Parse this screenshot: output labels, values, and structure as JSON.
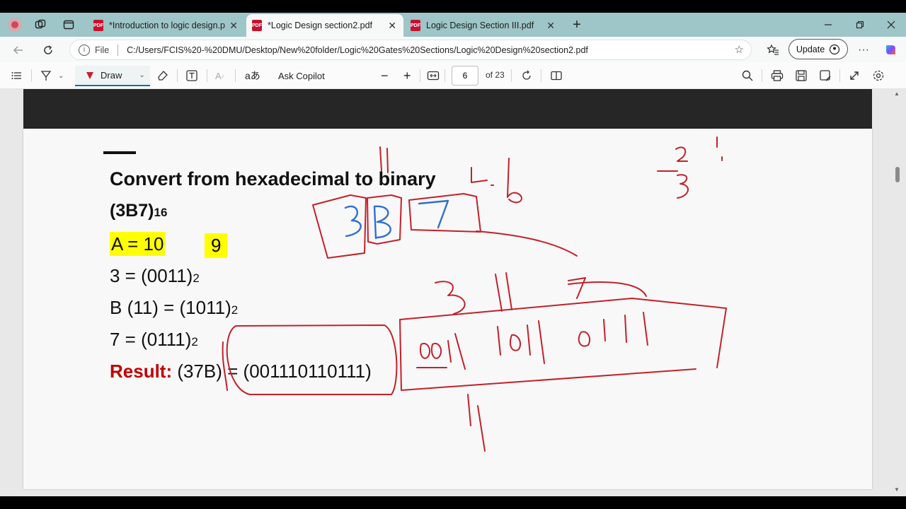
{
  "tabs": [
    {
      "label": "*Introduction to logic design.pdf",
      "active": false
    },
    {
      "label": "*Logic Design section2.pdf",
      "active": true
    },
    {
      "label": "Logic Design Section III.pdf",
      "active": false
    }
  ],
  "address": {
    "scheme": "File",
    "url": "C:/Users/FCIS%20-%20DMU/Desktop/New%20folder/Logic%20Gates%20Sections/Logic%20Design%20section2.pdf",
    "update_label": "Update"
  },
  "toolbar": {
    "draw_label": "Draw",
    "ask_copilot_label": "Ask Copilot",
    "page_number": "6",
    "page_total": "of 23"
  },
  "slide": {
    "title": "Convert from hexadecimal to binary",
    "number_main": "(3B7)",
    "number_base": "16",
    "a_line": "A = 10",
    "nine": "9",
    "line3_main": "3 = (0011)",
    "line3_base": "2",
    "lineb_main": "B (11) = (1011)",
    "lineb_base": "2",
    "line7_main": "7 = (0111)",
    "line7_base": "2",
    "result_label": "Result:",
    "result_value": " (37B) = (001110110111)"
  },
  "colors": {
    "ink_red": "#c4202a",
    "ink_blue": "#2f6fd0",
    "highlight": "#ffff00",
    "result_red": "#c00000"
  }
}
